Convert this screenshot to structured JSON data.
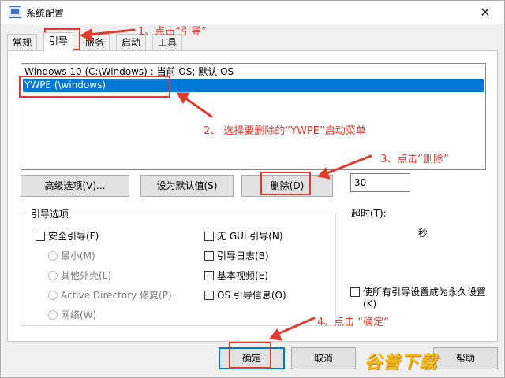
{
  "window": {
    "title": "系统配置",
    "close_glyph": "✕"
  },
  "tabs": [
    {
      "label": "常规"
    },
    {
      "label": "引导"
    },
    {
      "label": "服务"
    },
    {
      "label": "启动"
    },
    {
      "label": "工具"
    }
  ],
  "os_list": [
    "Windows 10 (C:\\Windows) : 当前 OS; 默认 OS",
    "YWPE (\\windows)"
  ],
  "buttons": {
    "advanced": "高级选项(V)...",
    "set_default": "设为默认值(S)",
    "delete": "删除(D)",
    "ok": "确定",
    "cancel": "取消",
    "help": "帮助"
  },
  "boot_options": {
    "title": "引导选项",
    "safe_boot": "安全引导(F)",
    "minimal": "最小(M)",
    "alternate_shell": "其他外壳(L)",
    "active_directory": "Active Directory 修复(P)",
    "network": "网络(W)",
    "no_gui": "无 GUI 引导(N)",
    "boot_log": "引导日志(B)",
    "base_video": "基本视频(E)",
    "os_boot_info": "OS 引导信息(O)"
  },
  "timeout": {
    "label": "超时(T):",
    "value": "30",
    "unit": "秒"
  },
  "permanent": {
    "line1": "使所有引导设置成为永久设置",
    "line2": "(K)"
  },
  "annotations": {
    "step1": "1、点击“引导”",
    "step2": "2、 选择要删除的“YWPE”启动菜单",
    "step3": "3、点击“删除”",
    "step4": "4、点击 “确定”",
    "color": "#e23a2e"
  },
  "watermark": "谷普下载"
}
